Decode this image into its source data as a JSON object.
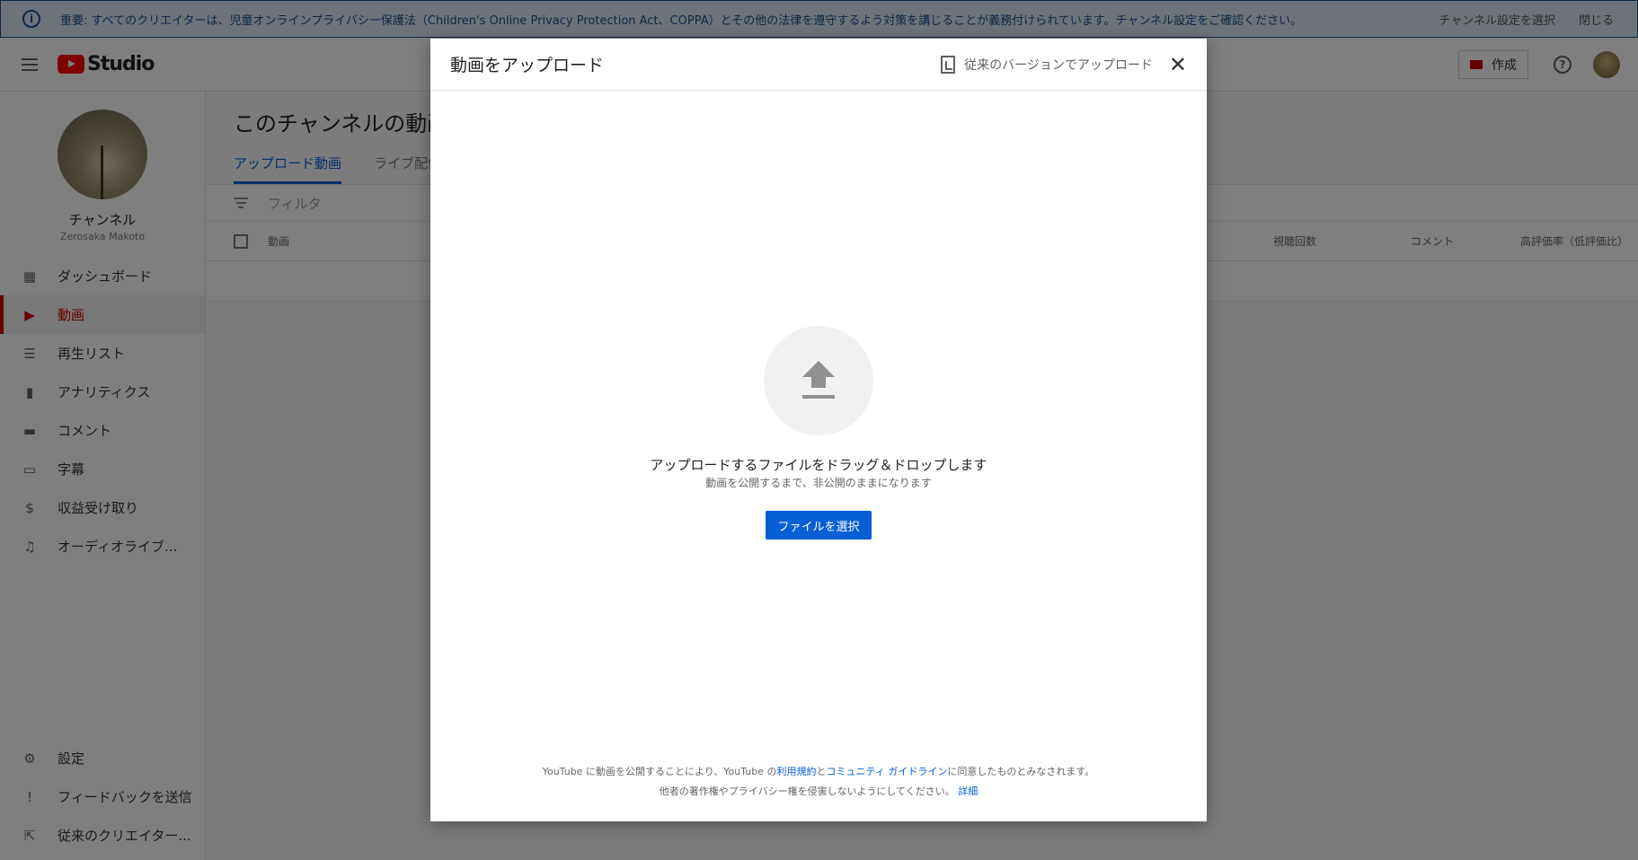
{
  "notice": {
    "text": "重要: すべてのクリエイターは、児童オンラインプライバシー保護法（Children's Online Privacy Protection Act、COPPA）とその他の法律を遵守するよう対策を講じることが義務付けられています。チャンネル設定をご確認ください。",
    "select_settings": "チャンネル設定を選択",
    "close": "閉じる"
  },
  "header": {
    "logo_text": "Studio",
    "create_label": "作成"
  },
  "channel": {
    "name": "チャンネル",
    "handle": "Zerosaka Makoto"
  },
  "sidebar": {
    "items": [
      {
        "label": "ダッシュボード",
        "icon": "dashboard-icon"
      },
      {
        "label": "動画",
        "icon": "video-icon"
      },
      {
        "label": "再生リスト",
        "icon": "playlist-icon"
      },
      {
        "label": "アナリティクス",
        "icon": "analytics-icon"
      },
      {
        "label": "コメント",
        "icon": "comment-icon"
      },
      {
        "label": "字幕",
        "icon": "subtitles-icon"
      },
      {
        "label": "収益受け取り",
        "icon": "dollar-icon"
      },
      {
        "label": "オーディオライブ...",
        "icon": "audio-library-icon"
      }
    ],
    "bottom": [
      {
        "label": "設定",
        "icon": "gear-icon"
      },
      {
        "label": "フィードバックを送信",
        "icon": "feedback-icon"
      },
      {
        "label": "従来のクリエイター...",
        "icon": "classic-studio-icon"
      }
    ]
  },
  "content": {
    "title": "このチャンネルの動画",
    "tabs": [
      "アップロード動画",
      "ライブ配信"
    ],
    "filter_placeholder": "フィルタ",
    "columns": {
      "video": "動画",
      "views": "視聴回数",
      "comments": "コメント",
      "like_ratio": "高評価率（低評価比）"
    }
  },
  "dialog": {
    "title": "動画をアップロード",
    "legacy_upload": "従来のバージョンでアップロード",
    "drag_main": "アップロードするファイルをドラッグ＆ドロップします",
    "drag_sub": "動画を公開するまで、非公開のままになります",
    "select_file": "ファイルを選択",
    "footer": {
      "part1": "YouTube に動画を公開することにより、YouTube の",
      "terms": "利用規約",
      "and": "と",
      "guidelines": "コミュニティ ガイドライン",
      "part2": "に同意したものとみなされます。",
      "line2": "他者の著作権やプライバシー権を侵害しないようにしてください。",
      "details": "詳細"
    }
  },
  "colors": {
    "accent_blue": "#065fd4",
    "brand_red": "#ff0000",
    "active_red": "#cc0000",
    "notice_bg": "#dde7f2"
  }
}
